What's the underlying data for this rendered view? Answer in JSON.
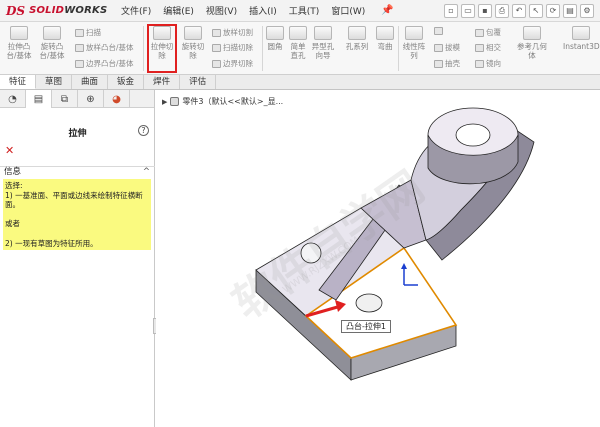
{
  "titlebar": {
    "logo_mark": "DS",
    "logo_solid": "SOLID",
    "logo_works": "WORKS",
    "menu": [
      "文件(F)",
      "编辑(E)",
      "视图(V)",
      "插入(I)",
      "工具(T)",
      "窗口(W)"
    ]
  },
  "ribbon": {
    "extrude_boss": "拉伸凸台/基体",
    "revolve_boss": "旋转凸台/基体",
    "sweep": "扫描",
    "loft": "放样凸台/基体",
    "boundary_boss": "边界凸台/基体",
    "extrude_cut": "拉伸切除",
    "revolve_cut": "旋转切除",
    "swept_cut": "放样切割",
    "sweep_cut": "扫描切除",
    "boundary_cut": "边界切除",
    "fillet": "圆角",
    "simple_hole": "简单直孔",
    "hole_wizard": "异型孔向导",
    "hole_series": "孔系列",
    "rib_label": "弯曲",
    "linear_pattern": "线性阵列",
    "draft": "拔模",
    "shell": "抽壳",
    "wrap": "包覆",
    "intersect": "相交",
    "mirror": "镜向",
    "reference_geometry": "参考几何体",
    "instant3d": "Instant3D"
  },
  "tabs": [
    "特征",
    "草图",
    "曲面",
    "钣金",
    "焊件",
    "评估"
  ],
  "panel": {
    "title": "拉伸",
    "help": "?",
    "cancel": "✕",
    "info_header": "信息",
    "chevron": "^",
    "info_lines": [
      "选择:",
      "1) 一基准面、平面或边线来绘制特征横断面。",
      "",
      "或者",
      "",
      "2) 一现有草图为特征所用。"
    ]
  },
  "viewport": {
    "tree_label": "零件3（默认<<默认>_显...",
    "tooltip": "凸台-拉伸1",
    "watermark": "软件自学网",
    "watermark_url": "WWW.RJZXW.COM"
  }
}
